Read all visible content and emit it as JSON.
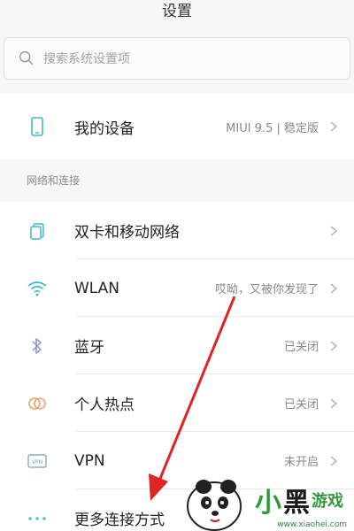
{
  "header": {
    "title": "设置"
  },
  "search": {
    "placeholder": "搜索系统设置项"
  },
  "device": {
    "label": "我的设备",
    "value": "MIUI 9.5 | 稳定版"
  },
  "network_section": {
    "header": "网络和连接",
    "items": [
      {
        "label": "双卡和移动网络",
        "value": "",
        "icon": "dual-sim-icon"
      },
      {
        "label": "WLAN",
        "value": "哎呦，又被你发现了",
        "icon": "wifi-icon"
      },
      {
        "label": "蓝牙",
        "value": "已关闭",
        "icon": "bluetooth-icon"
      },
      {
        "label": "个人热点",
        "value": "已关闭",
        "icon": "hotspot-icon"
      },
      {
        "label": "VPN",
        "value": "未开启",
        "icon": "vpn-icon"
      },
      {
        "label": "更多连接方式",
        "value": "",
        "icon": "more-icon"
      }
    ]
  },
  "colors": {
    "accent_teal": "#3fb8c6",
    "arrow_red": "#e02424",
    "brand_green": "#2f9a3a"
  },
  "watermark": {
    "text": "小黑游戏",
    "url": "www.xiaohei.com"
  }
}
